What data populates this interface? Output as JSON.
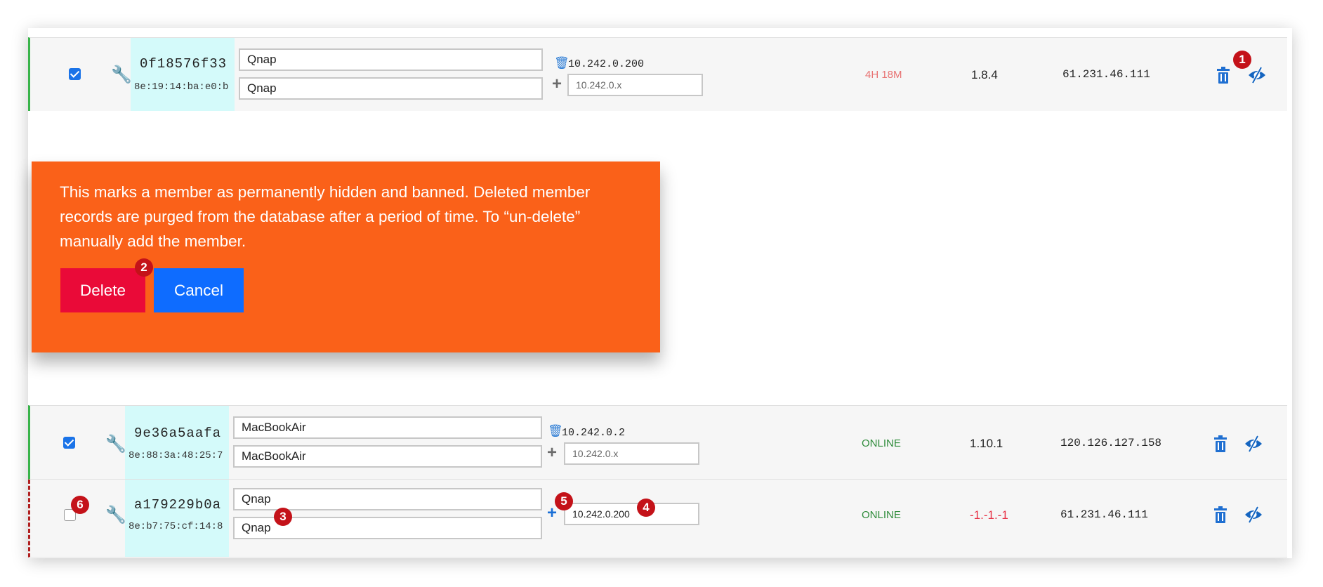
{
  "members": [
    {
      "checked": true,
      "node_id": "0f18576f33",
      "mac": "8e:19:14:ba:e0:b",
      "short_name": "Qnap",
      "name": "Qnap",
      "assigned_ip": "10.242.0.200",
      "ip_placeholder": "10.242.0.x",
      "ip_value": "",
      "status": "4H 18M",
      "status_color": "#e87373",
      "version": "1.8.4",
      "version_color": "#222222",
      "physical_ip": "61.231.46.111"
    },
    {
      "checked": true,
      "node_id": "9e36a5aafa",
      "mac": "8e:88:3a:48:25:7",
      "short_name": "MacBookAir",
      "name": "MacBookAir",
      "assigned_ip": "10.242.0.2",
      "ip_placeholder": "10.242.0.x",
      "ip_value": "",
      "status": "ONLINE",
      "status_color": "#2e8b3a",
      "version": "1.10.1",
      "version_color": "#222222",
      "physical_ip": "120.126.127.158"
    },
    {
      "checked": false,
      "node_id": "a179229b0a",
      "mac": "8e:b7:75:cf:14:8",
      "short_name": "Qnap",
      "name": "Qnap",
      "assigned_ip": "",
      "ip_placeholder": "10.242.0.x",
      "ip_value": "10.242.0.200",
      "status": "ONLINE",
      "status_color": "#2e8b3a",
      "version": "-1.-1.-1",
      "version_color": "#e8364a",
      "physical_ip": "61.231.46.111"
    }
  ],
  "icons": {
    "settings": "wrench-icon",
    "delete_ip": "trash-icon",
    "add_ip": "plus-icon",
    "delete_member": "trash-icon",
    "hide_member": "eye-slash-icon"
  },
  "delete_popup": {
    "message": "This marks a member as permanently hidden and banned. Deleted member records are purged from the database after a period of time. To “un-delete” manually add the member.",
    "delete_label": "Delete",
    "cancel_label": "Cancel",
    "background": "#fa6119",
    "delete_color": "#ea0a38",
    "cancel_color": "#0e6cff"
  },
  "annotations": [
    "1",
    "2",
    "3",
    "4",
    "5",
    "6"
  ],
  "colors": {
    "online_border": "#39b44a",
    "id_highlight": "#d4fafa",
    "accent_blue": "#1565c0",
    "badge": "#c41219"
  }
}
